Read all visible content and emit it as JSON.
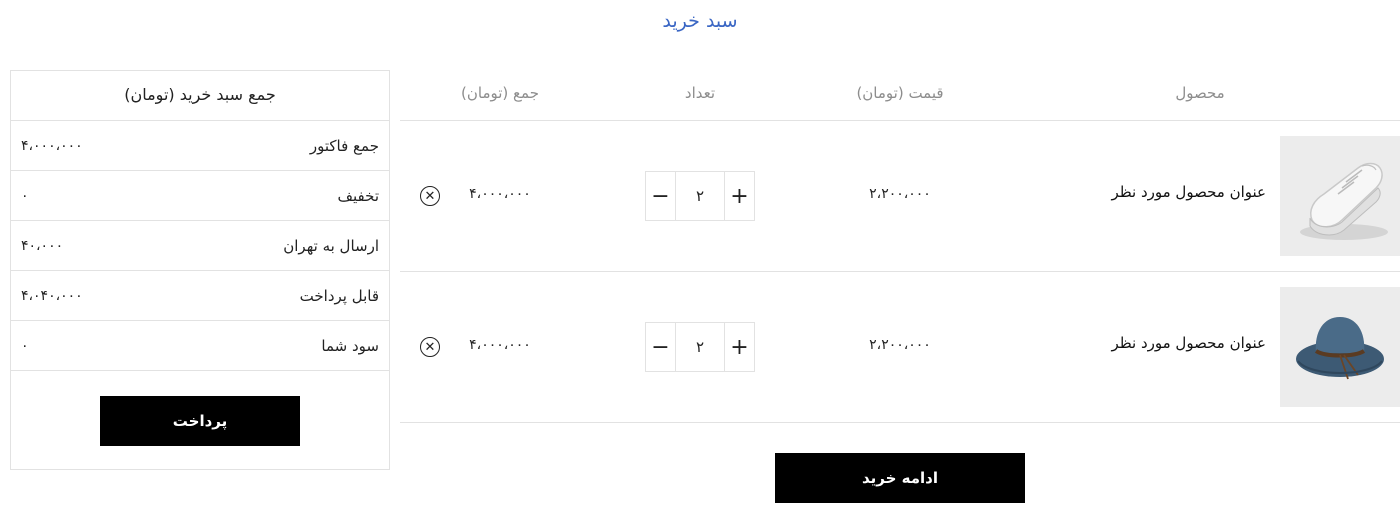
{
  "page": {
    "title": "سبد خرید"
  },
  "summary": {
    "title": "جمع سبد خرید (تومان)",
    "rows": [
      {
        "label": "جمع فاکتور",
        "value": "۴،۰۰۰،۰۰۰"
      },
      {
        "label": "تخفیف",
        "value": "۰"
      },
      {
        "label": "ارسال به تهران",
        "value": "۴۰،۰۰۰"
      },
      {
        "label": "قابل پرداخت",
        "value": "۴،۰۴۰،۰۰۰"
      },
      {
        "label": "سود شما",
        "value": "۰"
      }
    ],
    "pay_button": "پرداخت"
  },
  "cart": {
    "columns": {
      "product": "محصول",
      "price": "قیمت (تومان)",
      "quantity": "تعداد",
      "total": "جمع (تومان)"
    },
    "items": [
      {
        "name": "عنوان محصول مورد نظر",
        "price": "۲،۲۰۰،۰۰۰",
        "quantity": "۲",
        "total": "۴،۰۰۰،۰۰۰",
        "image_icon": "sneaker-image"
      },
      {
        "name": "عنوان محصول مورد نظر",
        "price": "۲،۲۰۰،۰۰۰",
        "quantity": "۲",
        "total": "۴،۰۰۰،۰۰۰",
        "image_icon": "hat-image"
      }
    ],
    "continue_button": "ادامه خرید"
  },
  "icons": {
    "minus": "−",
    "plus": "+",
    "remove": "✕"
  },
  "colors": {
    "title_blue": "#3a66c4",
    "button_black": "#000000",
    "header_gray": "#8d8d8d"
  }
}
